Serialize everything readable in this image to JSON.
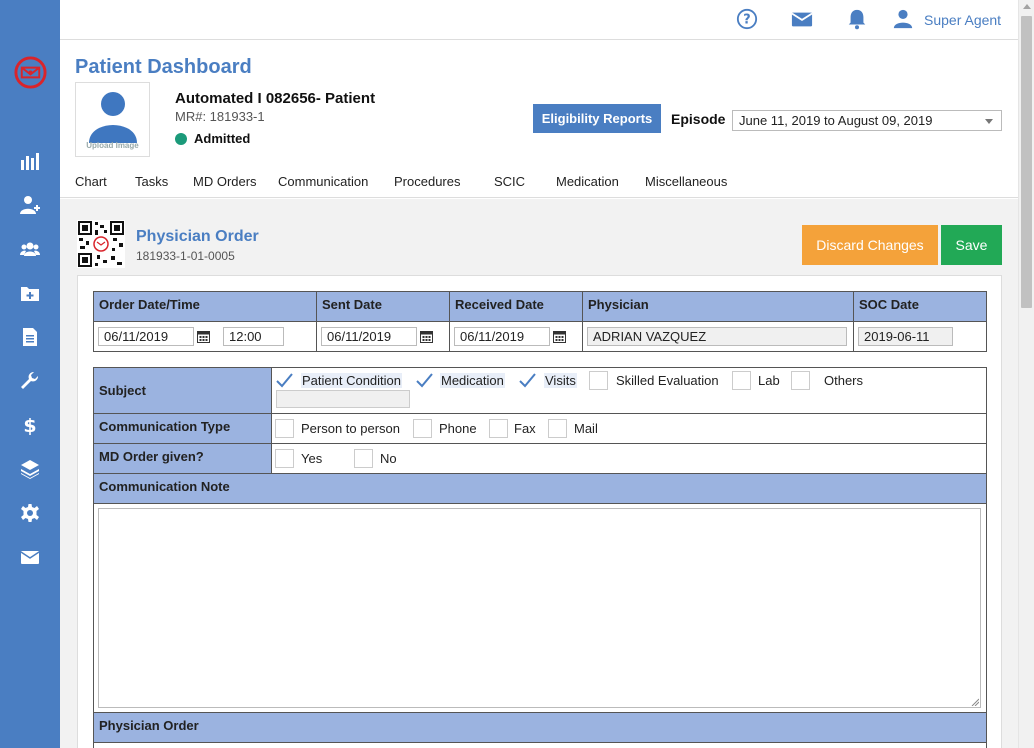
{
  "topbar": {
    "user_name": "Super Agent"
  },
  "header": {
    "title": "Patient Dashboard",
    "upload_text": "Upload Image",
    "patient_name": "Automated I 082656- Patient",
    "mr": "MR#: 181933-1",
    "status": "Admitted",
    "eligibility_btn": "Eligibility Reports",
    "episode_label": "Episode",
    "episode_value": "June 11, 2019 to August 09, 2019",
    "tabs": [
      "Chart",
      "Tasks",
      "MD Orders",
      "Communication",
      "Procedures",
      "SCIC",
      "Medication",
      "Miscellaneous"
    ]
  },
  "order": {
    "title": "Physician Order",
    "number": "181933-1-01-0005",
    "discard_btn": "Discard Changes",
    "save_btn": "Save",
    "columns": [
      "Order Date/Time",
      "Sent Date",
      "Received Date",
      "Physician",
      "SOC Date"
    ],
    "order_date": "06/11/2019",
    "order_time": "12:00",
    "sent_date": "06/11/2019",
    "received_date": "06/11/2019",
    "physician": "ADRIAN VAZQUEZ",
    "soc_date": "2019-06-11",
    "subject_label": "Subject",
    "subject_options": [
      {
        "label": "Patient Condition",
        "checked": true
      },
      {
        "label": "Medication",
        "checked": true
      },
      {
        "label": "Visits",
        "checked": true
      },
      {
        "label": "Skilled Evaluation",
        "checked": false
      },
      {
        "label": "Lab",
        "checked": false
      },
      {
        "label": "Others",
        "checked": false
      }
    ],
    "comm_type_label": "Communication Type",
    "comm_types": [
      {
        "label": "Person to person",
        "checked": false
      },
      {
        "label": "Phone",
        "checked": false
      },
      {
        "label": "Fax",
        "checked": false
      },
      {
        "label": "Mail",
        "checked": false
      }
    ],
    "md_given_label": "MD Order given?",
    "md_given": [
      {
        "label": "Yes",
        "checked": false
      },
      {
        "label": "No",
        "checked": false
      }
    ],
    "comm_note_label": "Communication Note",
    "physician_order_label": "Physician Order"
  },
  "colors": {
    "brand": "#4a7ec2",
    "header_cell": "#9bb3e0",
    "discard": "#f4a23a",
    "save": "#22a956",
    "admitted": "#1b9a7a"
  }
}
